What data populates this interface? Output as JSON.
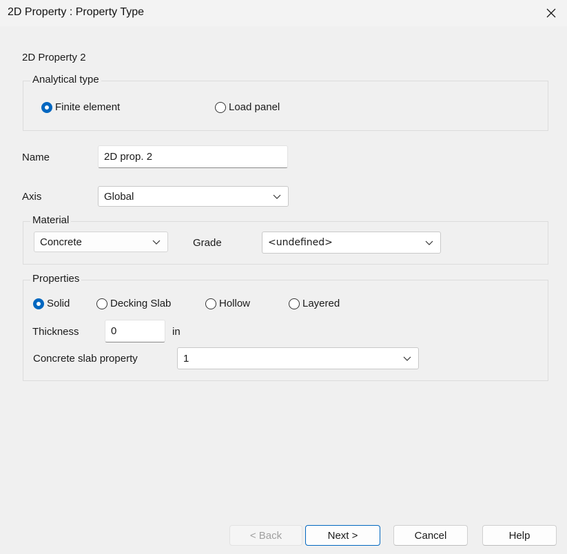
{
  "window": {
    "title": "2D Property : Property Type"
  },
  "header": {
    "property_name": "2D Property 2"
  },
  "analytical_type": {
    "legend": "Analytical type",
    "options": [
      {
        "label": "Finite element",
        "checked": true
      },
      {
        "label": "Load panel",
        "checked": false
      }
    ]
  },
  "name_field": {
    "label": "Name",
    "value": "2D prop. 2"
  },
  "axis_field": {
    "label": "Axis",
    "value": "Global"
  },
  "material": {
    "legend": "Material",
    "type_value": "Concrete",
    "grade_label": "Grade",
    "grade_value": "<undefined>"
  },
  "properties": {
    "legend": "Properties",
    "options": [
      {
        "label": "Solid",
        "checked": true
      },
      {
        "label": "Decking Slab",
        "checked": false
      },
      {
        "label": "Hollow",
        "checked": false
      },
      {
        "label": "Layered",
        "checked": false
      }
    ],
    "thickness_label": "Thickness",
    "thickness_value": "0",
    "thickness_unit": "in",
    "slab_label": "Concrete slab property",
    "slab_value": "1"
  },
  "buttons": {
    "back": "< Back",
    "next": "Next >",
    "cancel": "Cancel",
    "help": "Help"
  },
  "colors": {
    "accent": "#0067c0",
    "background": "#f0f0f0"
  },
  "icons": {
    "close": "close-icon",
    "dropdown": "chevron-down-icon"
  }
}
